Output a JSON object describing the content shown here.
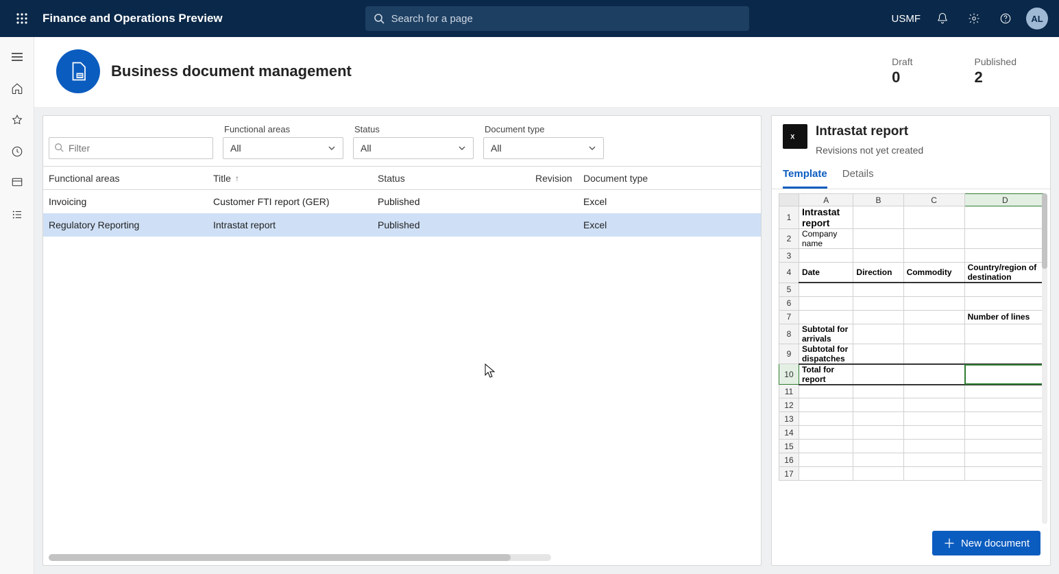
{
  "topbar": {
    "app_title": "Finance and Operations Preview",
    "search_placeholder": "Search for a page",
    "entity": "USMF",
    "avatar": "AL"
  },
  "page": {
    "title": "Business document management",
    "stats": {
      "draft_label": "Draft",
      "draft_value": "0",
      "published_label": "Published",
      "published_value": "2"
    }
  },
  "filters": {
    "filter_placeholder": "Filter",
    "functional_areas_label": "Functional areas",
    "status_label": "Status",
    "doctype_label": "Document type",
    "all": "All"
  },
  "grid": {
    "headers": {
      "fa": "Functional areas",
      "title": "Title",
      "status": "Status",
      "rev": "Revision",
      "doctype": "Document type"
    },
    "rows": [
      {
        "fa": "Invoicing",
        "title": "Customer FTI report (GER)",
        "status": "Published",
        "rev": "",
        "doctype": "Excel",
        "selected": false
      },
      {
        "fa": "Regulatory Reporting",
        "title": "Intrastat report",
        "status": "Published",
        "rev": "",
        "doctype": "Excel",
        "selected": true
      }
    ]
  },
  "right": {
    "title": "Intrastat report",
    "subtitle": "Revisions not yet created",
    "tabs": {
      "template": "Template",
      "details": "Details"
    },
    "new_doc": "New document"
  },
  "excel": {
    "cols": [
      "A",
      "B",
      "C",
      "D"
    ],
    "selected_col": "D",
    "selected_row": 10,
    "rows": [
      {
        "n": 1,
        "a": "Intrastat report",
        "bold": true
      },
      {
        "n": 2,
        "a": "Company name"
      },
      {
        "n": 3
      },
      {
        "n": 4,
        "a": "Date",
        "b": "Direction",
        "c": "Commodity",
        "d": "Country/region of destination",
        "hdr": true
      },
      {
        "n": 5
      },
      {
        "n": 6
      },
      {
        "n": 7,
        "d": "Number of lines",
        "dbold": true
      },
      {
        "n": 8,
        "a": "Subtotal for arrivals",
        "abold": true
      },
      {
        "n": 9,
        "a": "Subtotal for dispatches",
        "abold": true
      },
      {
        "n": 10,
        "a": "Total for report",
        "abold": true,
        "totalrow": true
      },
      {
        "n": 11
      },
      {
        "n": 12
      },
      {
        "n": 13
      },
      {
        "n": 14
      },
      {
        "n": 15
      },
      {
        "n": 16
      },
      {
        "n": 17
      }
    ]
  }
}
